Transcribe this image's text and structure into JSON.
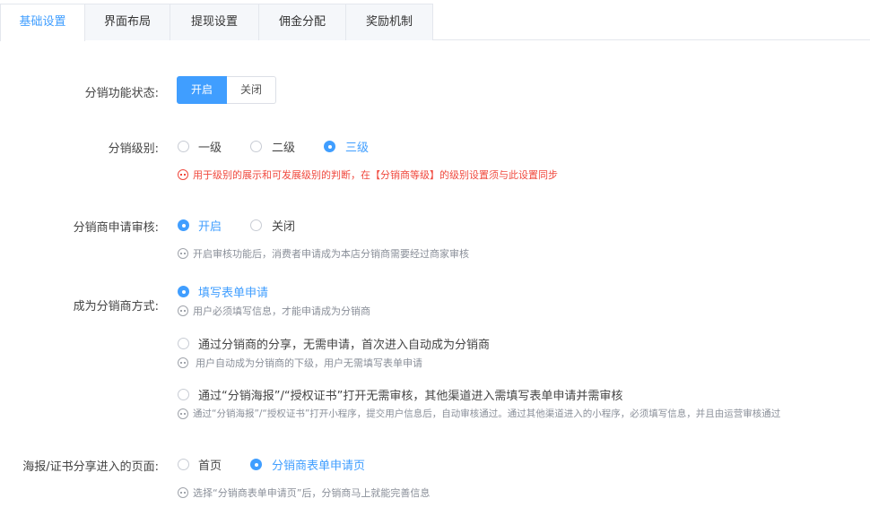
{
  "tabs": [
    "基础设置",
    "界面布局",
    "提现设置",
    "佣金分配",
    "奖励机制"
  ],
  "status": {
    "label": "分销功能状态:",
    "on": "开启",
    "off": "关闭"
  },
  "level": {
    "label": "分销级别:",
    "options": [
      "一级",
      "二级",
      "三级"
    ],
    "hint": "用于级别的展示和可发展级别的判断，在【分销商等级】的级别设置须与此设置同步"
  },
  "audit": {
    "label": "分销商申请审核:",
    "options": [
      "开启",
      "关闭"
    ],
    "hint": "开启审核功能后，消费者申请成为本店分销商需要经过商家审核"
  },
  "become": {
    "label": "成为分销商方式:",
    "options": [
      {
        "text": "填写表单申请",
        "hint": "用户必须填写信息，才能申请成为分销商"
      },
      {
        "text": "通过分销商的分享，无需申请，首次进入自动成为分销商",
        "hint": "用户自动成为分销商的下级，用户无需填写表单申请"
      },
      {
        "text": "通过“分销海报”/“授权证书”打开无需审核，其他渠道进入需填写表单申请并需审核",
        "hint": "通过“分销海报”/“授权证书”打开小程序，提交用户信息后，自动审核通过。通过其他渠道进入的小程序，必须填写信息，并且由运营审核通过"
      }
    ]
  },
  "entry": {
    "label": "海报/证书分享进入的页面:",
    "options": [
      "首页",
      "分销商表单申请页"
    ],
    "hint": "选择“分销商表单申请页”后，分销商马上就能完善信息"
  },
  "colors": {
    "accent": "#409eff",
    "warn": "#f0493e"
  }
}
